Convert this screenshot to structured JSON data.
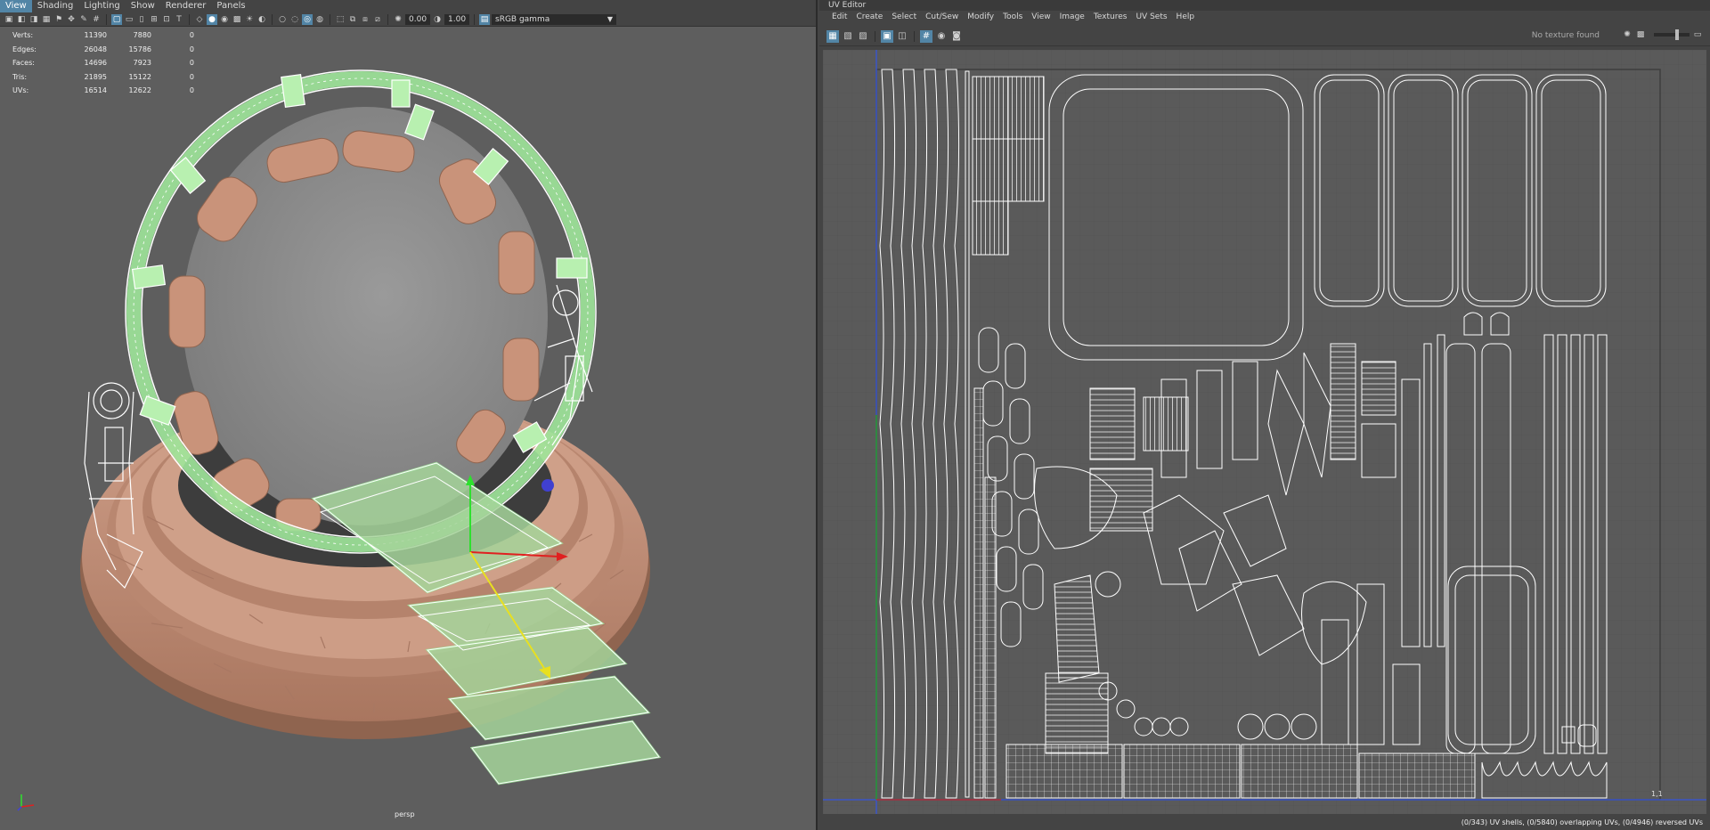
{
  "viewport": {
    "menu": [
      {
        "label": "View",
        "active": true
      },
      {
        "label": "Shading",
        "active": false
      },
      {
        "label": "Lighting",
        "active": false
      },
      {
        "label": "Show",
        "active": false
      },
      {
        "label": "Renderer",
        "active": false
      },
      {
        "label": "Panels",
        "active": false
      }
    ],
    "toolbar": {
      "exposure": "0.00",
      "gamma": "1.00",
      "color_space": "sRGB gamma"
    },
    "hud": [
      {
        "label": "Verts:",
        "v1": "11390",
        "v2": "7880",
        "v3": "0"
      },
      {
        "label": "Edges:",
        "v1": "26048",
        "v2": "15786",
        "v3": "0"
      },
      {
        "label": "Faces:",
        "v1": "14696",
        "v2": "7923",
        "v3": "0"
      },
      {
        "label": "Tris:",
        "v1": "21895",
        "v2": "15122",
        "v3": "0"
      },
      {
        "label": "UVs:",
        "v1": "16514",
        "v2": "12622",
        "v3": "0"
      }
    ],
    "camera": "persp",
    "colors": {
      "mesh": "#c9937a",
      "selection": "#9fe69a",
      "wire": "#ffffff",
      "background": "#5e5e5e"
    }
  },
  "uv_editor": {
    "title": "UV Editor",
    "menu": [
      "Edit",
      "Create",
      "Select",
      "Cut/Sew",
      "Modify",
      "Tools",
      "View",
      "Image",
      "Textures",
      "UV Sets",
      "Help"
    ],
    "no_texture": "No texture found",
    "status": "(0/343) UV shells, (0/5840) overlapping UVs, (0/4946) reversed UVs",
    "corner_label": "1,1"
  }
}
